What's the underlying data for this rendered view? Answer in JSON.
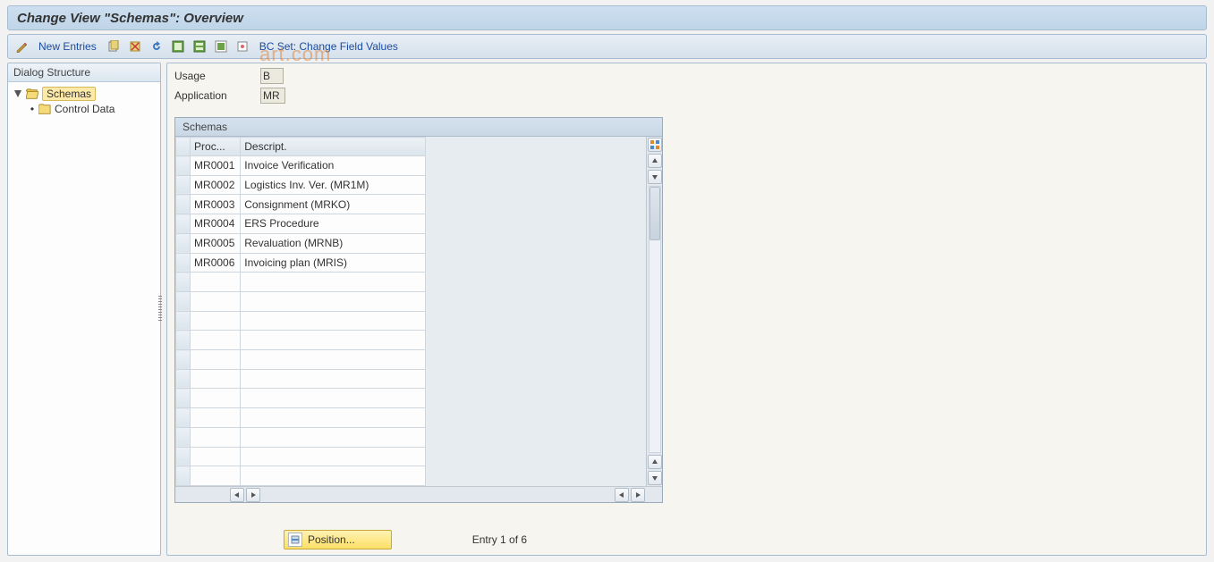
{
  "title": "Change View \"Schemas\": Overview",
  "toolbar": {
    "new_entries": "New Entries",
    "bc_set": "BC Set: Change Field Values"
  },
  "sidebar": {
    "header": "Dialog Structure",
    "node_schemas": "Schemas",
    "node_control_data": "Control Data"
  },
  "fields": {
    "usage_label": "Usage",
    "usage_value": "B",
    "application_label": "Application",
    "application_value": "MR"
  },
  "table": {
    "title": "Schemas",
    "col_proc": "Proc...",
    "col_desc": "Descript.",
    "rows": [
      {
        "proc": "MR0001",
        "desc": "Invoice Verification",
        "selected": true
      },
      {
        "proc": "MR0002",
        "desc": "Logistics Inv. Ver. (MR1M)"
      },
      {
        "proc": "MR0003",
        "desc": "Consignment (MRKO)"
      },
      {
        "proc": "MR0004",
        "desc": "ERS Procedure"
      },
      {
        "proc": "MR0005",
        "desc": "Revaluation (MRNB)"
      },
      {
        "proc": "MR0006",
        "desc": "Invoicing plan (MRIS)"
      }
    ],
    "empty_rows": 11
  },
  "footer": {
    "position_label": "Position...",
    "entry_label": "Entry 1 of 6"
  },
  "watermark": "art.com"
}
